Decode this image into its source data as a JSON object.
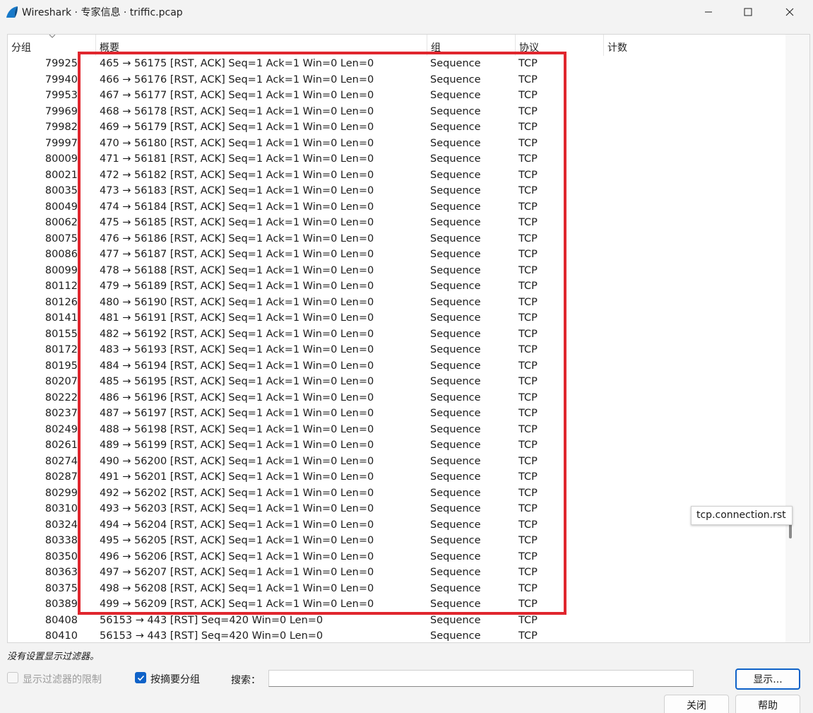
{
  "window": {
    "title": "Wireshark · 专家信息 · triffic.pcap"
  },
  "table": {
    "columns": [
      "分组",
      "概要",
      "组",
      "协议",
      "计数"
    ],
    "rows": [
      {
        "num": "79925",
        "summary": "465 → 56175 [RST, ACK] Seq=1 Ack=1 Win=0 Len=0",
        "group": "Sequence",
        "protocol": "TCP"
      },
      {
        "num": "79940",
        "summary": "466 → 56176 [RST, ACK] Seq=1 Ack=1 Win=0 Len=0",
        "group": "Sequence",
        "protocol": "TCP"
      },
      {
        "num": "79953",
        "summary": "467 → 56177 [RST, ACK] Seq=1 Ack=1 Win=0 Len=0",
        "group": "Sequence",
        "protocol": "TCP"
      },
      {
        "num": "79969",
        "summary": "468 → 56178 [RST, ACK] Seq=1 Ack=1 Win=0 Len=0",
        "group": "Sequence",
        "protocol": "TCP"
      },
      {
        "num": "79982",
        "summary": "469 → 56179 [RST, ACK] Seq=1 Ack=1 Win=0 Len=0",
        "group": "Sequence",
        "protocol": "TCP"
      },
      {
        "num": "79997",
        "summary": "470 → 56180 [RST, ACK] Seq=1 Ack=1 Win=0 Len=0",
        "group": "Sequence",
        "protocol": "TCP"
      },
      {
        "num": "80009",
        "summary": "471 → 56181 [RST, ACK] Seq=1 Ack=1 Win=0 Len=0",
        "group": "Sequence",
        "protocol": "TCP"
      },
      {
        "num": "80021",
        "summary": "472 → 56182 [RST, ACK] Seq=1 Ack=1 Win=0 Len=0",
        "group": "Sequence",
        "protocol": "TCP"
      },
      {
        "num": "80035",
        "summary": "473 → 56183 [RST, ACK] Seq=1 Ack=1 Win=0 Len=0",
        "group": "Sequence",
        "protocol": "TCP"
      },
      {
        "num": "80049",
        "summary": "474 → 56184 [RST, ACK] Seq=1 Ack=1 Win=0 Len=0",
        "group": "Sequence",
        "protocol": "TCP"
      },
      {
        "num": "80062",
        "summary": "475 → 56185 [RST, ACK] Seq=1 Ack=1 Win=0 Len=0",
        "group": "Sequence",
        "protocol": "TCP"
      },
      {
        "num": "80075",
        "summary": "476 → 56186 [RST, ACK] Seq=1 Ack=1 Win=0 Len=0",
        "group": "Sequence",
        "protocol": "TCP"
      },
      {
        "num": "80086",
        "summary": "477 → 56187 [RST, ACK] Seq=1 Ack=1 Win=0 Len=0",
        "group": "Sequence",
        "protocol": "TCP"
      },
      {
        "num": "80099",
        "summary": "478 → 56188 [RST, ACK] Seq=1 Ack=1 Win=0 Len=0",
        "group": "Sequence",
        "protocol": "TCP"
      },
      {
        "num": "80112",
        "summary": "479 → 56189 [RST, ACK] Seq=1 Ack=1 Win=0 Len=0",
        "group": "Sequence",
        "protocol": "TCP"
      },
      {
        "num": "80126",
        "summary": "480 → 56190 [RST, ACK] Seq=1 Ack=1 Win=0 Len=0",
        "group": "Sequence",
        "protocol": "TCP"
      },
      {
        "num": "80141",
        "summary": "481 → 56191 [RST, ACK] Seq=1 Ack=1 Win=0 Len=0",
        "group": "Sequence",
        "protocol": "TCP"
      },
      {
        "num": "80155",
        "summary": "482 → 56192 [RST, ACK] Seq=1 Ack=1 Win=0 Len=0",
        "group": "Sequence",
        "protocol": "TCP"
      },
      {
        "num": "80172",
        "summary": "483 → 56193 [RST, ACK] Seq=1 Ack=1 Win=0 Len=0",
        "group": "Sequence",
        "protocol": "TCP"
      },
      {
        "num": "80195",
        "summary": "484 → 56194 [RST, ACK] Seq=1 Ack=1 Win=0 Len=0",
        "group": "Sequence",
        "protocol": "TCP"
      },
      {
        "num": "80207",
        "summary": "485 → 56195 [RST, ACK] Seq=1 Ack=1 Win=0 Len=0",
        "group": "Sequence",
        "protocol": "TCP"
      },
      {
        "num": "80222",
        "summary": "486 → 56196 [RST, ACK] Seq=1 Ack=1 Win=0 Len=0",
        "group": "Sequence",
        "protocol": "TCP"
      },
      {
        "num": "80237",
        "summary": "487 → 56197 [RST, ACK] Seq=1 Ack=1 Win=0 Len=0",
        "group": "Sequence",
        "protocol": "TCP"
      },
      {
        "num": "80249",
        "summary": "488 → 56198 [RST, ACK] Seq=1 Ack=1 Win=0 Len=0",
        "group": "Sequence",
        "protocol": "TCP"
      },
      {
        "num": "80261",
        "summary": "489 → 56199 [RST, ACK] Seq=1 Ack=1 Win=0 Len=0",
        "group": "Sequence",
        "protocol": "TCP"
      },
      {
        "num": "80274",
        "summary": "490 → 56200 [RST, ACK] Seq=1 Ack=1 Win=0 Len=0",
        "group": "Sequence",
        "protocol": "TCP"
      },
      {
        "num": "80287",
        "summary": "491 → 56201 [RST, ACK] Seq=1 Ack=1 Win=0 Len=0",
        "group": "Sequence",
        "protocol": "TCP"
      },
      {
        "num": "80299",
        "summary": "492 → 56202 [RST, ACK] Seq=1 Ack=1 Win=0 Len=0",
        "group": "Sequence",
        "protocol": "TCP"
      },
      {
        "num": "80310",
        "summary": "493 → 56203 [RST, ACK] Seq=1 Ack=1 Win=0 Len=0",
        "group": "Sequence",
        "protocol": "TCP"
      },
      {
        "num": "80324",
        "summary": "494 → 56204 [RST, ACK] Seq=1 Ack=1 Win=0 Len=0",
        "group": "Sequence",
        "protocol": "TCP"
      },
      {
        "num": "80338",
        "summary": "495 → 56205 [RST, ACK] Seq=1 Ack=1 Win=0 Len=0",
        "group": "Sequence",
        "protocol": "TCP"
      },
      {
        "num": "80350",
        "summary": "496 → 56206 [RST, ACK] Seq=1 Ack=1 Win=0 Len=0",
        "group": "Sequence",
        "protocol": "TCP"
      },
      {
        "num": "80363",
        "summary": "497 → 56207 [RST, ACK] Seq=1 Ack=1 Win=0 Len=0",
        "group": "Sequence",
        "protocol": "TCP"
      },
      {
        "num": "80375",
        "summary": "498 → 56208 [RST, ACK] Seq=1 Ack=1 Win=0 Len=0",
        "group": "Sequence",
        "protocol": "TCP"
      },
      {
        "num": "80389",
        "summary": "499 → 56209 [RST, ACK] Seq=1 Ack=1 Win=0 Len=0",
        "group": "Sequence",
        "protocol": "TCP"
      },
      {
        "num": "80408",
        "summary": "56153 → 443 [RST] Seq=420 Win=0 Len=0",
        "group": "Sequence",
        "protocol": "TCP"
      },
      {
        "num": "80410",
        "summary": "56153 → 443 [RST] Seq=420 Win=0 Len=0",
        "group": "Sequence",
        "protocol": "TCP"
      }
    ]
  },
  "tooltip": "tcp.connection.rst",
  "status_text": "没有设置显示过滤器。",
  "controls": {
    "limit_filter_label": "显示过滤器的限制",
    "limit_filter_checked": false,
    "group_by_summary_label": "按摘要分组",
    "group_by_summary_checked": true,
    "search_label": "搜索：",
    "search_value": "",
    "show_button": "显示...",
    "close_button": "关闭",
    "help_button": "帮助"
  },
  "colors": {
    "highlight_box": "#e0262e",
    "accent": "#0f62c8"
  }
}
